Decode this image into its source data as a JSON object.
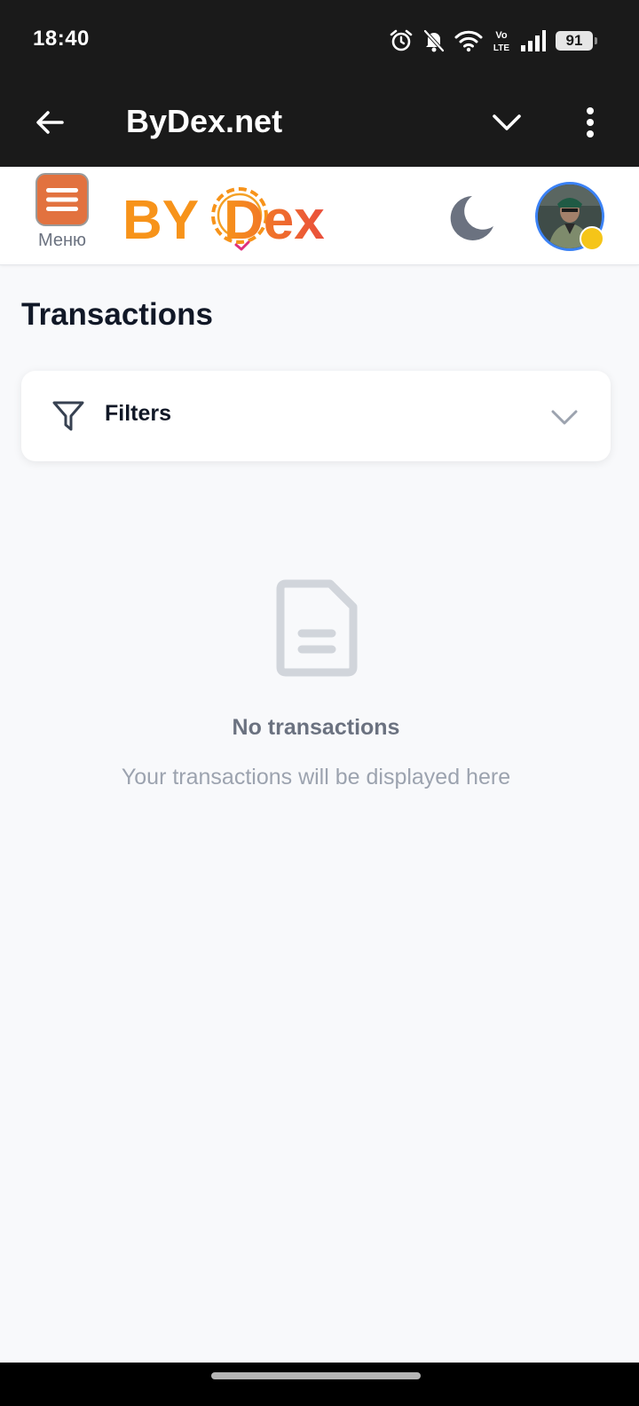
{
  "status_bar": {
    "time": "18:40",
    "network_label": "Vo LTE",
    "battery_level": "91"
  },
  "browser": {
    "title": "ByDex.net"
  },
  "header": {
    "menu_label": "Меню",
    "logo_text": "BYDex"
  },
  "main": {
    "title": "Transactions",
    "filters_label": "Filters",
    "empty_title": "No transactions",
    "empty_subtitle": "Your transactions will be displayed here"
  },
  "icons": {
    "status": [
      "alarm-icon",
      "notifications-off-icon",
      "wifi-icon",
      "volte-icon",
      "signal-icon",
      "battery-icon"
    ],
    "toolbar": [
      "back-arrow-icon",
      "chevron-down-icon",
      "more-vert-icon"
    ],
    "header": [
      "hamburger-icon",
      "moon-icon"
    ],
    "content": [
      "filter-icon",
      "chevron-down-icon",
      "document-icon"
    ]
  },
  "colors": {
    "system_bar": "#1a1a1a",
    "menu_button": "#e2723f",
    "logo_orange": "#f7931a",
    "logo_red": "#e94e3c",
    "avatar_ring": "#3b82f6",
    "page_background": "#f8f9fb",
    "heading": "#111827",
    "muted": "#9ca3af"
  }
}
